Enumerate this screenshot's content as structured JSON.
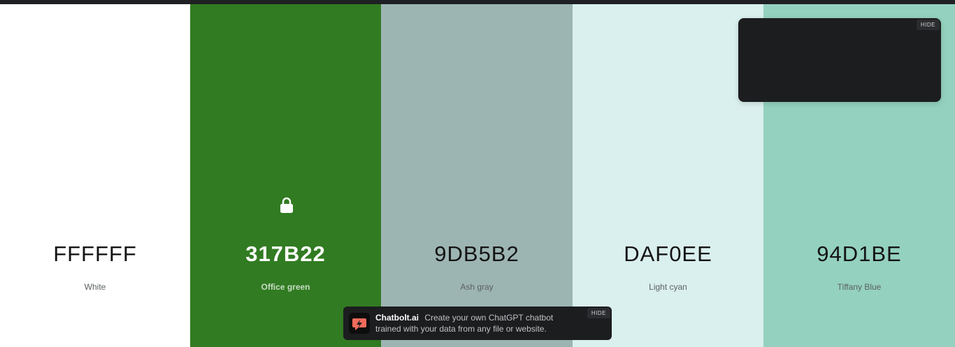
{
  "swatches": [
    {
      "hex": "FFFFFF",
      "name": "White",
      "color": "#FFFFFF",
      "text_style": "dark",
      "locked": false
    },
    {
      "hex": "317B22",
      "name": "Office green",
      "color": "#317B22",
      "text_style": "light",
      "locked": true
    },
    {
      "hex": "9DB5B2",
      "name": "Ash gray",
      "color": "#9DB5B2",
      "text_style": "dark",
      "locked": false
    },
    {
      "hex": "DAF0EE",
      "name": "Light cyan",
      "color": "#DAF0EE",
      "text_style": "dark",
      "locked": false
    },
    {
      "hex": "94D1BE",
      "name": "Tiffany Blue",
      "color": "#94D1BE",
      "text_style": "dark",
      "locked": false
    }
  ],
  "ad_top": {
    "hide_label": "HIDE"
  },
  "ad_bottom": {
    "brand": "Chatbolt.ai",
    "text": "Create your own ChatGPT chatbot trained with your data from any file or website.",
    "hide_label": "HIDE",
    "logo_icon": "lightning-chat-icon",
    "logo_color": "#F26B5B"
  },
  "icons": {
    "lock": "lock-icon"
  }
}
